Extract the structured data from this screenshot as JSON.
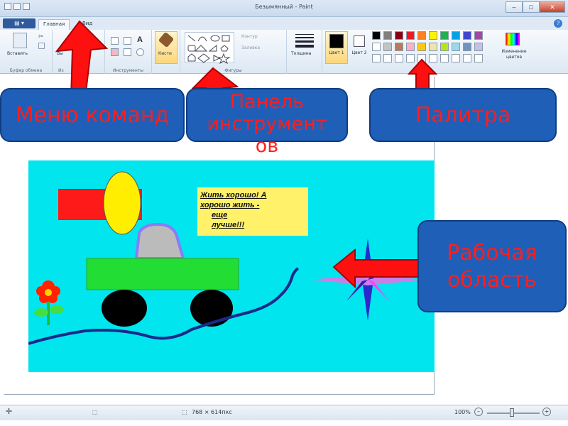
{
  "window": {
    "title": "Безымянный - Paint",
    "minimize": "–",
    "maximize": "□",
    "close": "✕"
  },
  "tabs": {
    "home": "Главная",
    "view": "Вид",
    "help": "?"
  },
  "ribbon": {
    "paste": "Вставить",
    "clipboard_group": "Буфер обмена",
    "image_btn": "Вы",
    "image_group": "Из",
    "tools_group": "Инструменты",
    "brushes": "Кисти",
    "shapes_group": "Фигуры",
    "outline": "Контур",
    "fill": "Заливка",
    "size": "Толщина",
    "color1": "Цвет 1",
    "color2": "Цвет 2",
    "edit_colors": "Изменение цветов",
    "palette_row1": [
      "#000000",
      "#7f7f7f",
      "#880015",
      "#ed1c24",
      "#ff7f27",
      "#fff200",
      "#22b14c",
      "#00a2e8",
      "#3f48cc",
      "#a349a4"
    ],
    "palette_row2": [
      "#ffffff",
      "#c3c3c3",
      "#b97a57",
      "#ffaec9",
      "#ffc90e",
      "#efe4b0",
      "#b5e61d",
      "#99d9ea",
      "#7092be",
      "#c8bfe7"
    ],
    "color1_value": "#000000",
    "color2_value": "#ffffff"
  },
  "status": {
    "size_text": "768 × 614пкс",
    "zoom": "100%"
  },
  "callouts": {
    "menu": "Меню команд",
    "toolbar_line1": "Панель",
    "toolbar_line2": "инструмент",
    "toolbar_line3": "ов",
    "palette": "Палитра",
    "work_line1": "Рабочая",
    "work_line2": "область"
  },
  "drawing": {
    "note_line1": "Жить хорошо! А",
    "note_line2": "хорошо жить -",
    "note_line3": "еще",
    "note_line4": "лучше!!!",
    "background": "#00e5ee"
  }
}
